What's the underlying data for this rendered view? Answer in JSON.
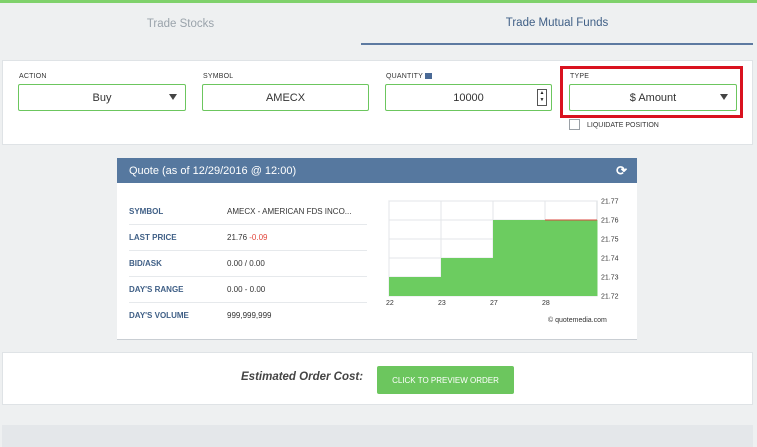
{
  "tabs": [
    {
      "label": "Trade Stocks",
      "active": false
    },
    {
      "label": "Trade Mutual Funds",
      "active": true
    }
  ],
  "form": {
    "action": {
      "label": "ACTION",
      "value": "Buy"
    },
    "symbol": {
      "label": "SYMBOL",
      "value": "AMECX"
    },
    "quantity": {
      "label": "QUANTITY",
      "value": "10000"
    },
    "type": {
      "label": "TYPE",
      "value": "$ Amount"
    },
    "liquidate_label": "LIQUIDATE POSITION"
  },
  "quote": {
    "title": "Quote (as of 12/29/2016 @ 12:00)",
    "rows": [
      {
        "key": "SYMBOL",
        "value": "AMECX - AMERICAN FDS INCO..."
      },
      {
        "key": "LAST PRICE",
        "value": "21.76",
        "change": "-0.09"
      },
      {
        "key": "BID/ASK",
        "value": "0.00 / 0.00"
      },
      {
        "key": "DAY'S RANGE",
        "value": "0.00 - 0.00"
      },
      {
        "key": "DAY'S VOLUME",
        "value": "999,999,999"
      }
    ],
    "watermark": "© quotemedia.com"
  },
  "chart_data": {
    "type": "area",
    "x": [
      "22",
      "23",
      "27",
      "28"
    ],
    "y_ticks": [
      "21.77",
      "21.76",
      "21.75",
      "21.74",
      "21.73",
      "21.72"
    ],
    "ylim": [
      21.72,
      21.77
    ],
    "values": [
      21.73,
      21.74,
      21.76,
      21.76
    ],
    "colors": {
      "fill": "#6ccc60",
      "last_line": "#d9473d"
    }
  },
  "order": {
    "cost_label": "Estimated Order Cost:",
    "preview_button": "CLICK TO PREVIEW ORDER"
  },
  "colors": {
    "accent": "#6cc65e",
    "header": "#56789f",
    "highlight": "#d9121f"
  }
}
